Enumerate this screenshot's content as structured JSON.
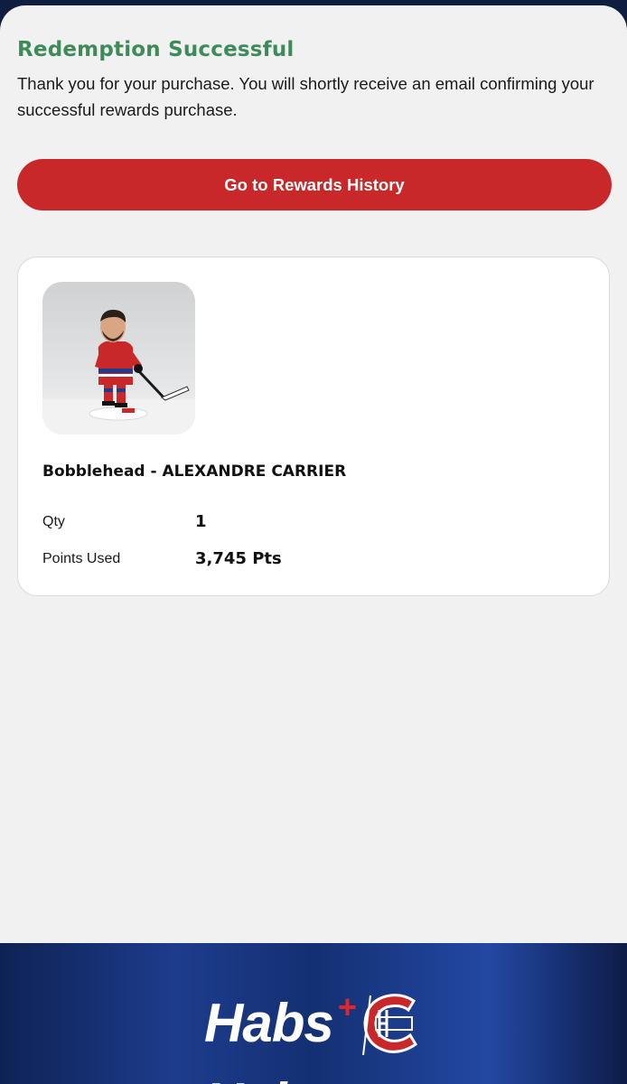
{
  "confirmation": {
    "title": "Redemption Successful",
    "message": "Thank you for your purchase. You will shortly receive an email confirming your successful rewards purchase.",
    "history_button_label": "Go to Rewards History"
  },
  "order": {
    "product_name": "Bobblehead - ALEXANDRE CARRIER",
    "qty_label": "Qty",
    "qty_value": "1",
    "points_label": "Points Used",
    "points_value": "3,745 Pts"
  },
  "footer": {
    "brand_text": "Habs",
    "brand_plus": "+",
    "brand_text_repeat": "Habs"
  },
  "colors": {
    "title_green": "#3e8b59",
    "button_red": "#c8282a",
    "footer_blue": "#1d3c8c"
  },
  "icons": {
    "product": "bobblehead-photo",
    "crest": "canadiens-logo"
  }
}
